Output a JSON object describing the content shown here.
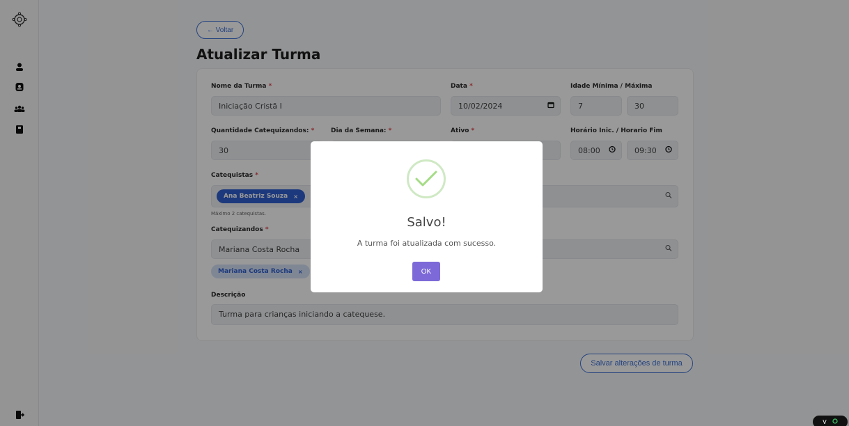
{
  "nav": {
    "back_label": "← Voltar"
  },
  "page": {
    "title": "Atualizar Turma"
  },
  "form": {
    "nome": {
      "label": "Nome da Turma",
      "value": "Iniciação Cristã I"
    },
    "data": {
      "label": "Data",
      "value": "10/02/2024"
    },
    "idade": {
      "label": "Idade Mínima / Máxima",
      "min": "7",
      "max": "30"
    },
    "quantidade": {
      "label": "Quantidade Catequizandos:",
      "value": "30"
    },
    "dia": {
      "label": "Dia da Semana:"
    },
    "ativo": {
      "label": "Ativo"
    },
    "horario": {
      "label": "Horário Inic. / Horario Fim",
      "inicio": "08:00",
      "fim": "09:30"
    },
    "catequistas": {
      "label": "Catequistas",
      "chip": "Ana Beatriz Souza",
      "hint": "Máximo 2 catequistas."
    },
    "catequizandos": {
      "label": "Catequizandos",
      "search_value": "Mariana Costa Rocha",
      "chip": "Mariana Costa Rocha"
    },
    "descricao": {
      "label": "Descrição",
      "value": "Turma para crianças iniciando a catequese."
    },
    "required_mark": "*"
  },
  "actions": {
    "save_label": "Salvar alterações de turma"
  },
  "modal": {
    "title": "Salvo!",
    "message": "A turma foi atualizada com sucesso.",
    "ok_label": "OK"
  },
  "badge": {
    "label": "V"
  },
  "colors": {
    "accent": "#3b6fd6",
    "success": "#a5dc86",
    "ok_button": "#7d6ad8",
    "required": "#e0464c"
  }
}
